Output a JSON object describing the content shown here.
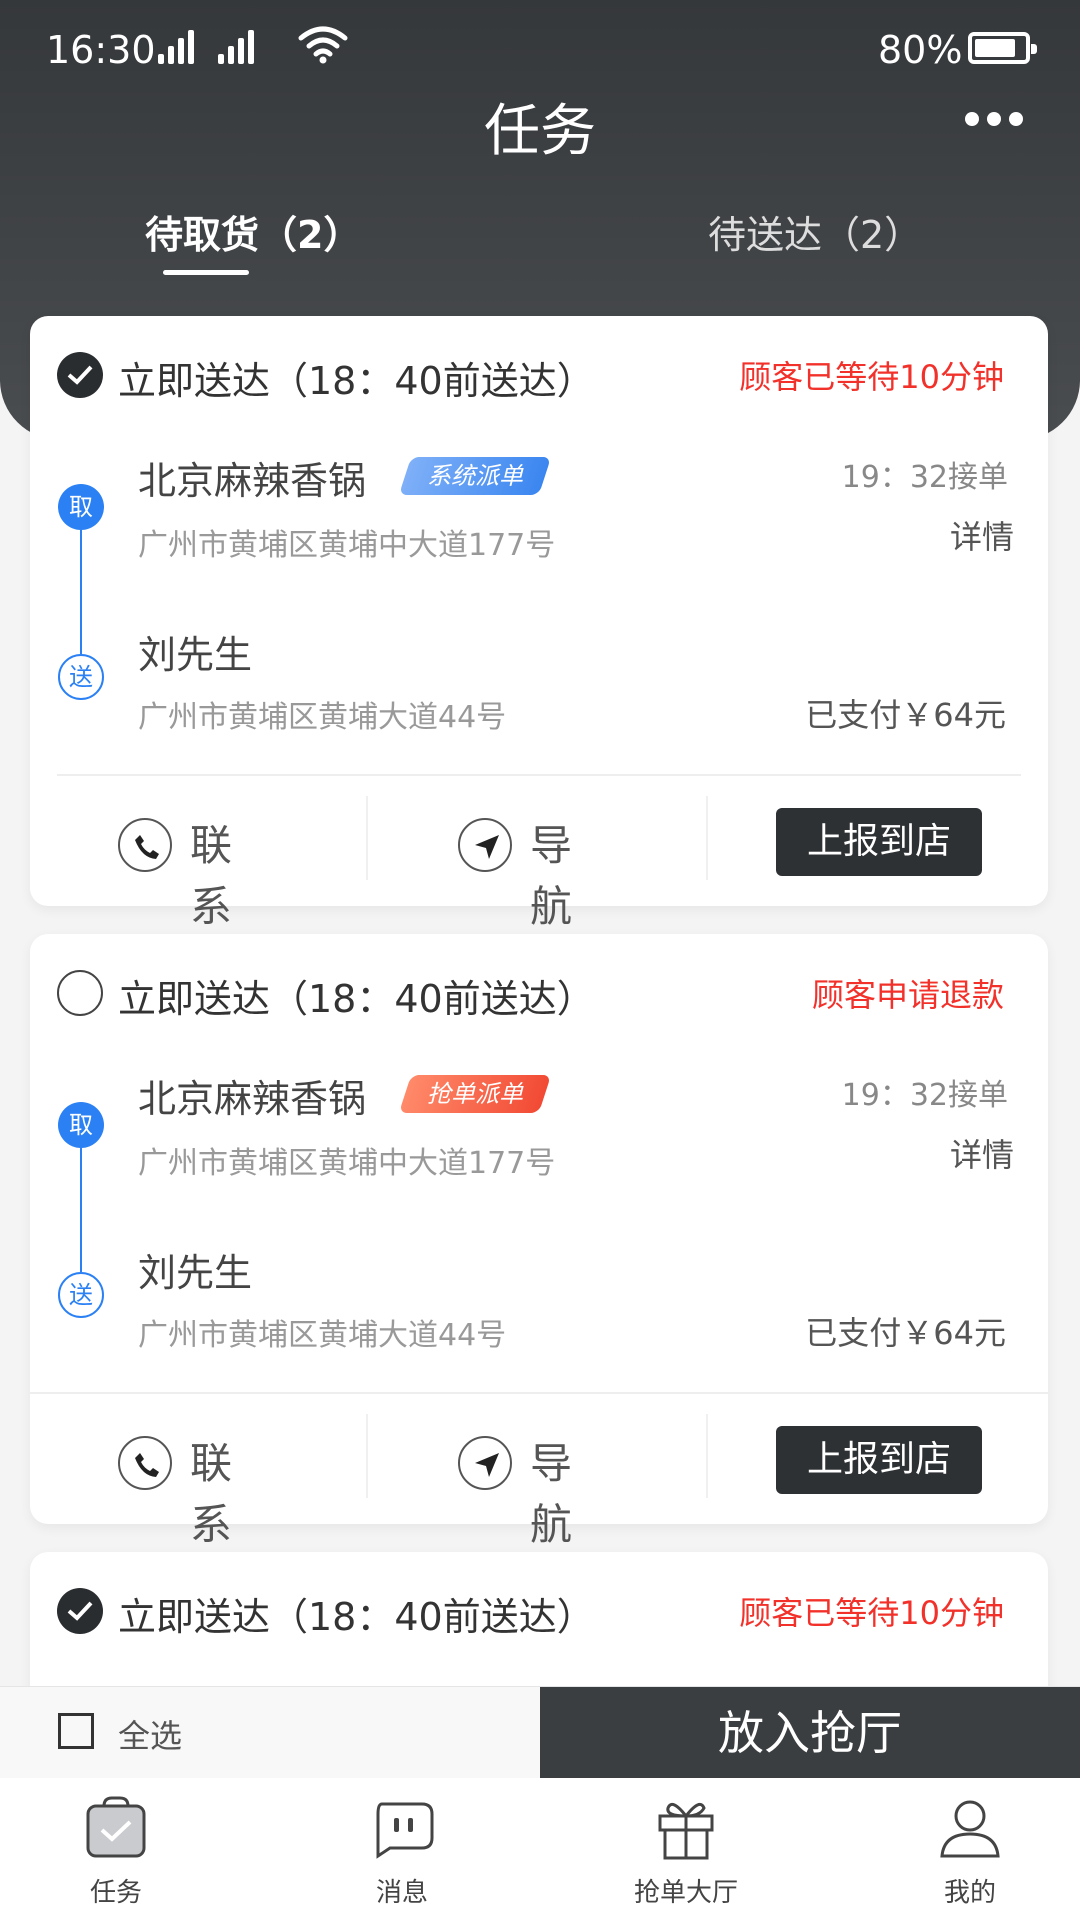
{
  "status_bar": {
    "time": "16:30",
    "battery": "80%"
  },
  "header": {
    "title": "任务"
  },
  "tabs": [
    {
      "label": "待取货（2）",
      "active": true
    },
    {
      "label": "待送达（2）",
      "active": false
    }
  ],
  "orders": [
    {
      "checked": true,
      "delivery_type": "立即送达（18：40前送达）",
      "alert": "顾客已等待10分钟",
      "shop": "北京麻辣香锅",
      "badge": "系统派单",
      "shop_address": "广州市黄埔区黄埔中大道177号",
      "accept_time": "19：32接单",
      "detail": "详情",
      "customer": "刘先生",
      "customer_address": "广州市黄埔区黄埔大道44号",
      "paid": "已支付￥64元",
      "contact": "联系",
      "navigate": "导航",
      "report": "上报到店",
      "pickup_mark": "取",
      "deliver_mark": "送"
    },
    {
      "checked": false,
      "delivery_type": "立即送达（18：40前送达）",
      "alert": "顾客申请退款",
      "shop": "北京麻辣香锅",
      "badge": "抢单派单",
      "shop_address": "广州市黄埔区黄埔中大道177号",
      "accept_time": "19：32接单",
      "detail": "详情",
      "customer": "刘先生",
      "customer_address": "广州市黄埔区黄埔大道44号",
      "paid": "已支付￥64元",
      "contact": "联系",
      "navigate": "导航",
      "report": "上报到店",
      "pickup_mark": "取",
      "deliver_mark": "送"
    },
    {
      "checked": true,
      "delivery_type": "立即送达（18：40前送达）",
      "alert": "顾客已等待10分钟"
    }
  ],
  "bottom_bar": {
    "select_all": "全选",
    "put_in_button": "放入抢厅"
  },
  "tabbar": [
    {
      "label": "任务",
      "icon": "task-icon"
    },
    {
      "label": "消息",
      "icon": "message-icon"
    },
    {
      "label": "抢单大厅",
      "icon": "gift-icon"
    },
    {
      "label": "我的",
      "icon": "user-icon"
    }
  ],
  "colors": {
    "header": "#3b3e41",
    "alert": "#f2312b",
    "accent_blue": "#2b81f4",
    "dark_button": "#2e3134"
  }
}
